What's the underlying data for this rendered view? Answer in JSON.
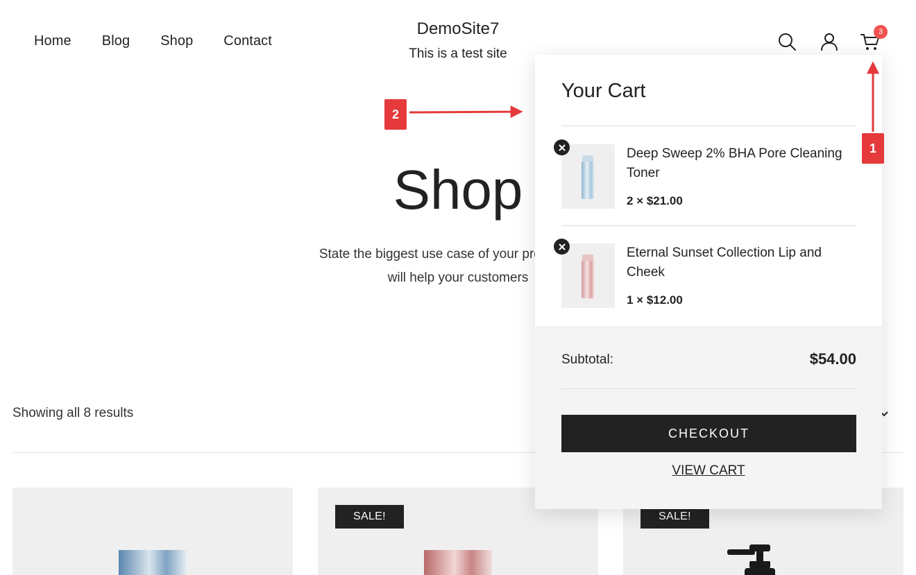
{
  "nav": {
    "items": [
      "Home",
      "Blog",
      "Shop",
      "Contact"
    ]
  },
  "site": {
    "title": "DemoSite7",
    "tagline": "This is a test site"
  },
  "header": {
    "cart_count": "3"
  },
  "page": {
    "heading": "Shop",
    "intro_line1": "State the biggest use case of your product. Brie",
    "intro_line2": "will help your customers"
  },
  "results": {
    "text": "Showing all 8 results"
  },
  "products": [
    {
      "badge": ""
    },
    {
      "badge": "SALE!"
    },
    {
      "badge": "SALE!"
    }
  ],
  "cart": {
    "title": "Your Cart",
    "items": [
      {
        "name": "Deep Sweep 2% BHA Pore Cleaning Toner",
        "qty_price": "2 × $21.00",
        "color": "#a9c7dc"
      },
      {
        "name": "Eternal Sunset Collection Lip and Cheek",
        "qty_price": "1 × $12.00",
        "color": "#dca3a3"
      }
    ],
    "subtotal_label": "Subtotal:",
    "subtotal_value": "$54.00",
    "checkout_label": "CHECKOUT",
    "view_cart_label": "VIEW CART"
  },
  "annotations": {
    "marker1": "1",
    "marker2": "2",
    "color": "#e5393b"
  }
}
